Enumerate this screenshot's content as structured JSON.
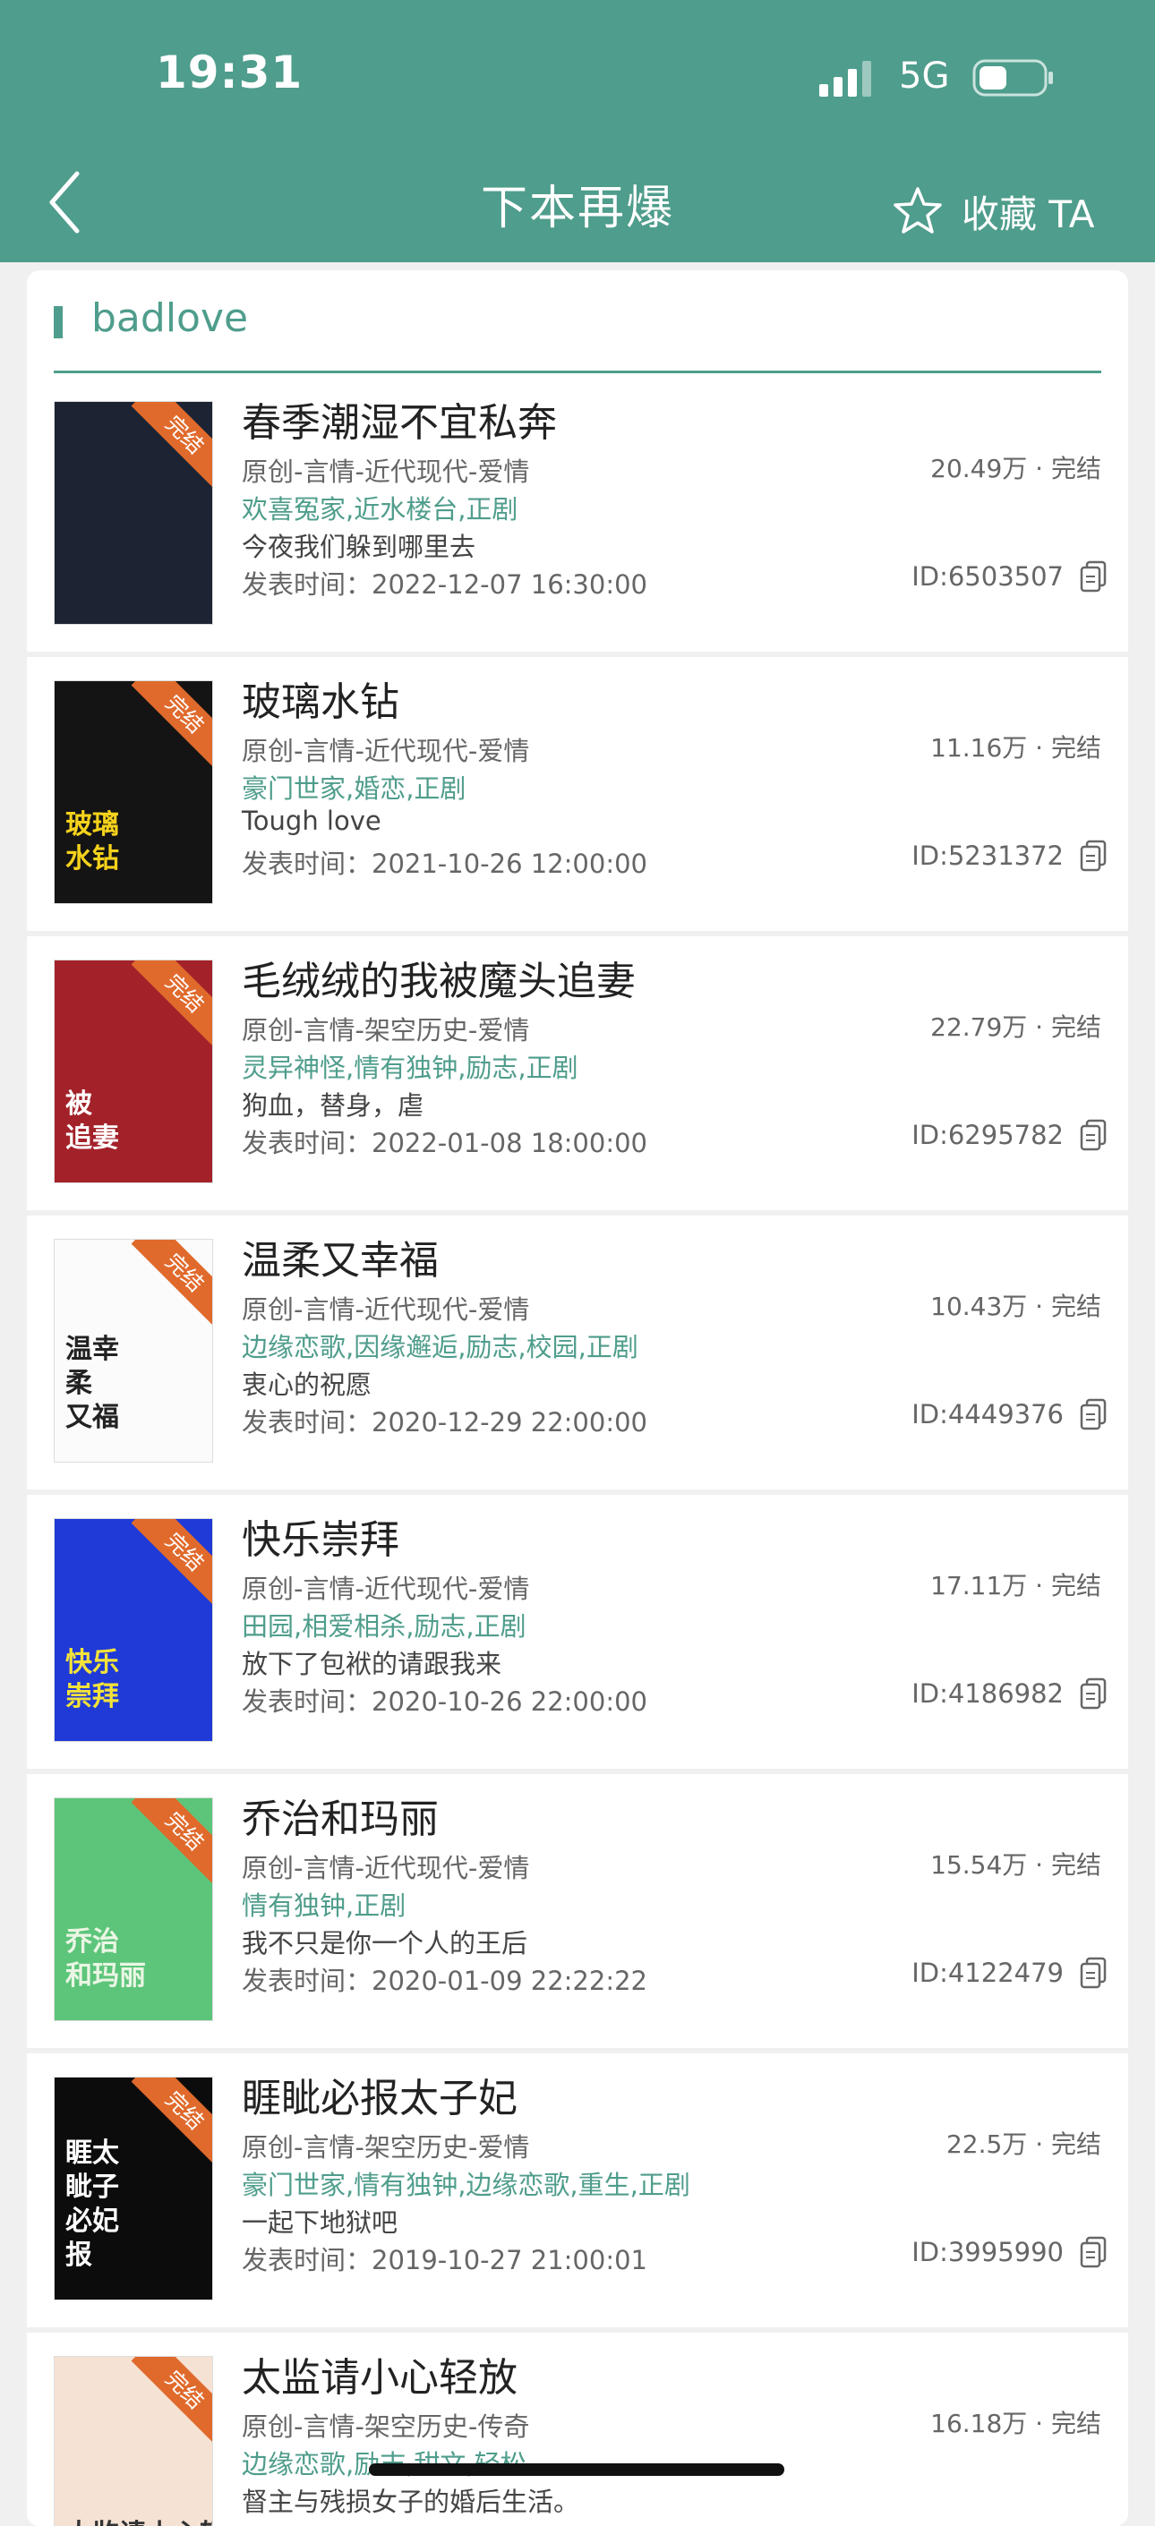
{
  "status_bar": {
    "time": "19:31",
    "network": "5G"
  },
  "nav": {
    "title": "下本再爆",
    "favorite_label": "收藏 TA"
  },
  "section": {
    "title": "badlove"
  },
  "books": [
    {
      "title": "春季潮湿不宜私奔",
      "meta": "原创-言情-近代现代-爱情",
      "tags": "欢喜冤家,近水楼台,正剧",
      "desc": "今夜我们躲到哪里去",
      "date": "发表时间：2022-12-07 16:30:00",
      "stats": "20.49万 · 完结",
      "id": "ID:6503507",
      "badge": "完结",
      "cover_bg": "#1c2333",
      "cover_fg": "#7a8595",
      "cover_text": ""
    },
    {
      "title": "玻璃水钻",
      "meta": "原创-言情-近代现代-爱情",
      "tags": "豪门世家,婚恋,正剧",
      "desc": "Tough love",
      "date": "发表时间：2021-10-26 12:00:00",
      "stats": "11.16万 · 完结",
      "id": "ID:5231372",
      "badge": "完结",
      "cover_bg": "#141414",
      "cover_fg": "#f5d21c",
      "cover_text": "玻璃\n水钻"
    },
    {
      "title": "毛绒绒的我被魔头追妻",
      "meta": "原创-言情-架空历史-爱情",
      "tags": "灵异神怪,情有独钟,励志,正剧",
      "desc": "狗血，替身，虐",
      "date": "发表时间：2022-01-08 18:00:00",
      "stats": "22.79万 · 完结",
      "id": "ID:6295782",
      "badge": "完结",
      "cover_bg": "#a3222a",
      "cover_fg": "#ffffff",
      "cover_text": "被\n追妻"
    },
    {
      "title": "温柔又幸福",
      "meta": "原创-言情-近代现代-爱情",
      "tags": "边缘恋歌,因缘邂逅,励志,校园,正剧",
      "desc": "衷心的祝愿",
      "date": "发表时间：2020-12-29 22:00:00",
      "stats": "10.43万 · 完结",
      "id": "ID:4449376",
      "badge": "完结",
      "cover_bg": "#fbfbfb",
      "cover_fg": "#222222",
      "cover_text": "温幸\n柔\n又福"
    },
    {
      "title": "快乐崇拜",
      "meta": "原创-言情-近代现代-爱情",
      "tags": "田园,相爱相杀,励志,正剧",
      "desc": "放下了包袱的请跟我来",
      "date": "发表时间：2020-10-26 22:00:00",
      "stats": "17.11万 · 完结",
      "id": "ID:4186982",
      "badge": "完结",
      "cover_bg": "#1f3ad6",
      "cover_fg": "#f3e23a",
      "cover_text": "快乐\n崇拜"
    },
    {
      "title": "乔治和玛丽",
      "meta": "原创-言情-近代现代-爱情",
      "tags": "情有独钟,正剧",
      "desc": "我不只是你一个人的王后",
      "date": "发表时间：2020-01-09 22:22:22",
      "stats": "15.54万 · 完结",
      "id": "ID:4122479",
      "badge": "完结",
      "cover_bg": "#5cc57a",
      "cover_fg": "#eaf6e4",
      "cover_text": "乔治\n和玛丽"
    },
    {
      "title": "睚眦必报太子妃",
      "meta": "原创-言情-架空历史-爱情",
      "tags": "豪门世家,情有独钟,边缘恋歌,重生,正剧",
      "desc": "一起下地狱吧",
      "date": "发表时间：2019-10-27 21:00:01",
      "stats": "22.5万 · 完结",
      "id": "ID:3995990",
      "badge": "完结",
      "cover_bg": "#0c0c0c",
      "cover_fg": "#ffffff",
      "cover_text": "睚太\n眦子\n必妃\n报"
    },
    {
      "title": "太监请小心轻放",
      "meta": "原创-言情-架空历史-传奇",
      "tags": "边缘恋歌,励志,甜文,轻松",
      "desc": "督主与残损女子的婚后生活。",
      "date": "",
      "stats": "16.18万 · 完结",
      "id": "",
      "badge": "完结",
      "cover_bg": "#f6e2d4",
      "cover_fg": "#333333",
      "cover_text": "太监请小心轻放"
    }
  ]
}
